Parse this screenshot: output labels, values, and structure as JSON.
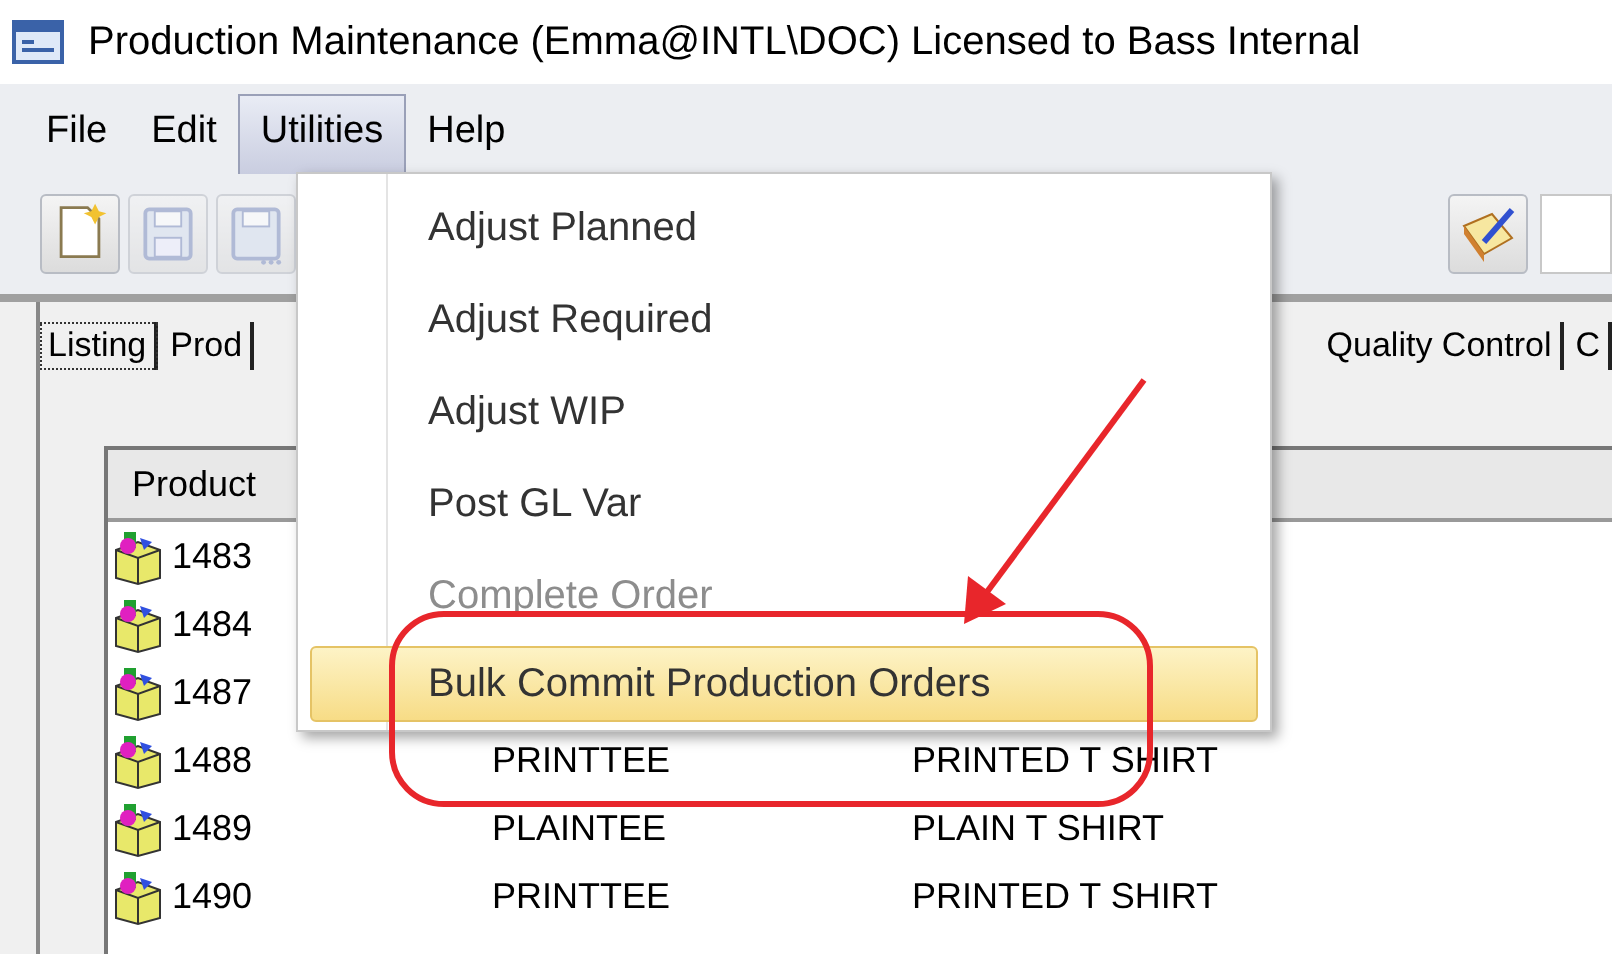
{
  "window": {
    "title": "Production Maintenance (Emma@INTL\\DOC) Licensed to Bass Internal"
  },
  "menu_bar": [
    {
      "label": "File",
      "selected": false
    },
    {
      "label": "Edit",
      "selected": false
    },
    {
      "label": "Utilities",
      "selected": true
    },
    {
      "label": "Help",
      "selected": false
    }
  ],
  "toolbar": [
    {
      "kind": "new",
      "disabled": false
    },
    {
      "kind": "save",
      "disabled": true
    },
    {
      "kind": "save-as",
      "disabled": true
    }
  ],
  "tabs": [
    {
      "label": "Listing",
      "selected": true
    },
    {
      "label": "Prod",
      "selected": false
    },
    {
      "label": "Quality Control",
      "selected": false
    },
    {
      "label": "C",
      "selected": false
    }
  ],
  "table": {
    "columns": [
      "Product"
    ],
    "rows": [
      {
        "cells": [
          "1483"
        ]
      },
      {
        "cells": [
          "1484"
        ]
      },
      {
        "cells": [
          "1487"
        ]
      },
      {
        "cells": [
          "1488",
          "PRINTTEE",
          "PRINTED T SHIRT"
        ]
      },
      {
        "cells": [
          "1489",
          "PLAINTEE",
          "PLAIN T SHIRT"
        ]
      },
      {
        "cells": [
          "1490",
          "PRINTTEE",
          "PRINTED T SHIRT"
        ]
      }
    ]
  },
  "dropdown_menu": {
    "items": [
      {
        "label": "Adjust Planned",
        "disabled": false,
        "selected": false
      },
      {
        "label": "Adjust Required",
        "disabled": false,
        "selected": false
      },
      {
        "label": "Adjust WIP",
        "disabled": false,
        "selected": false
      },
      {
        "label": "Post GL Var",
        "disabled": false,
        "selected": false
      },
      {
        "label": "Complete Order",
        "disabled": true,
        "selected": false
      },
      {
        "label": "Bulk Commit Production Orders",
        "disabled": false,
        "selected": true
      }
    ]
  }
}
